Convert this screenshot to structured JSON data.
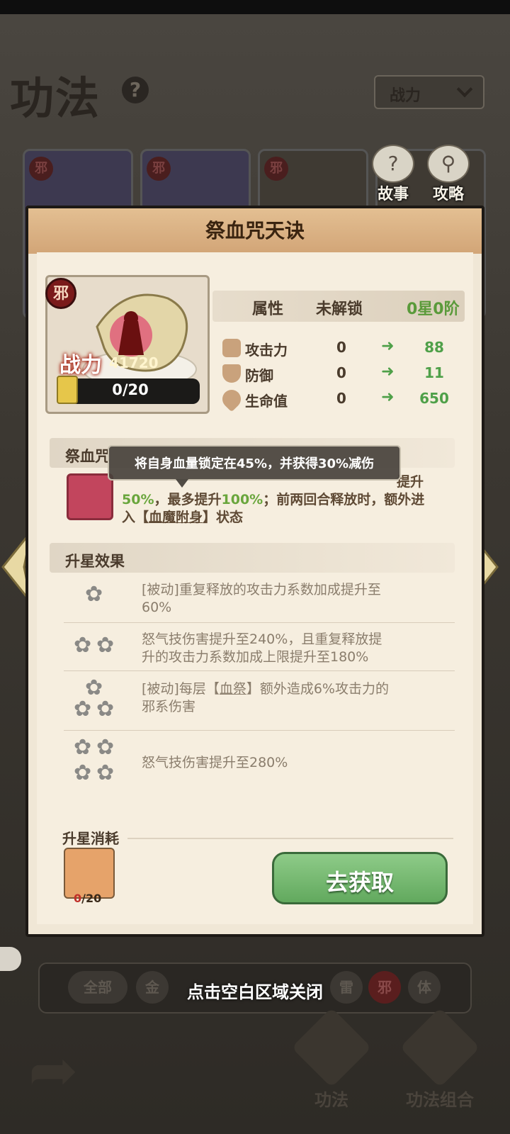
{
  "background": {
    "title": "功法",
    "help_symbol": "?",
    "sort": {
      "selected": "战力"
    },
    "card_badges": [
      "邪",
      "邪",
      "邪"
    ],
    "top_icons": [
      {
        "label": "故事"
      },
      {
        "label": "攻略"
      }
    ],
    "filters": [
      "全部",
      "金",
      "雷",
      "邪",
      "体"
    ],
    "close_hint": "点击空白区域关闭",
    "tabs": [
      {
        "label": "功法"
      },
      {
        "label": "功法组合"
      }
    ]
  },
  "dialog": {
    "title": "祭血咒天诀",
    "badge": "邪",
    "power_label": "战力",
    "power_value": "41720",
    "fragments": "0/20",
    "stats": {
      "header": {
        "attr": "属性",
        "state": "未解锁",
        "level": "0星0阶"
      },
      "rows": [
        {
          "label": "攻击力",
          "current": "0",
          "next": "88",
          "icon": "sword-icon"
        },
        {
          "label": "防御",
          "current": "0",
          "next": "11",
          "icon": "shield-icon"
        },
        {
          "label": "生命值",
          "current": "0",
          "next": "650",
          "icon": "heart-icon"
        }
      ]
    },
    "skill": {
      "section_title": "祭血咒",
      "line1_tail": "提升",
      "line2_a": "50%",
      "line2_b": "，最多提升",
      "line2_c": "100%",
      "line2_d": "；前两回合释放时，额外进",
      "line3_a": "入【",
      "line3_link": "血魔附身",
      "line3_b": "】状态"
    },
    "tooltip": "将自身血量锁定在45%，并获得30%减伤",
    "upgrade": {
      "section_title": "升星效果",
      "rows": [
        {
          "stars": 1,
          "lines": [
            "[被动]重复释放的攻击力系数加成提升至",
            "60%"
          ]
        },
        {
          "stars": 2,
          "lines": [
            "怒气技伤害提升至240%，且重复释放提",
            "升的攻击力系数加成上限提升至180%"
          ]
        },
        {
          "stars": 3,
          "lines_a": "[被动]每层【",
          "link": "血祭",
          "lines_b": "】额外造成6%攻击力的",
          "line2": "邪系伤害"
        },
        {
          "stars": 4,
          "lines": [
            "怒气技伤害提升至280%"
          ]
        }
      ]
    },
    "cost": {
      "label": "升星消耗",
      "have": "0",
      "need": "/20"
    },
    "get_button": "去获取"
  }
}
